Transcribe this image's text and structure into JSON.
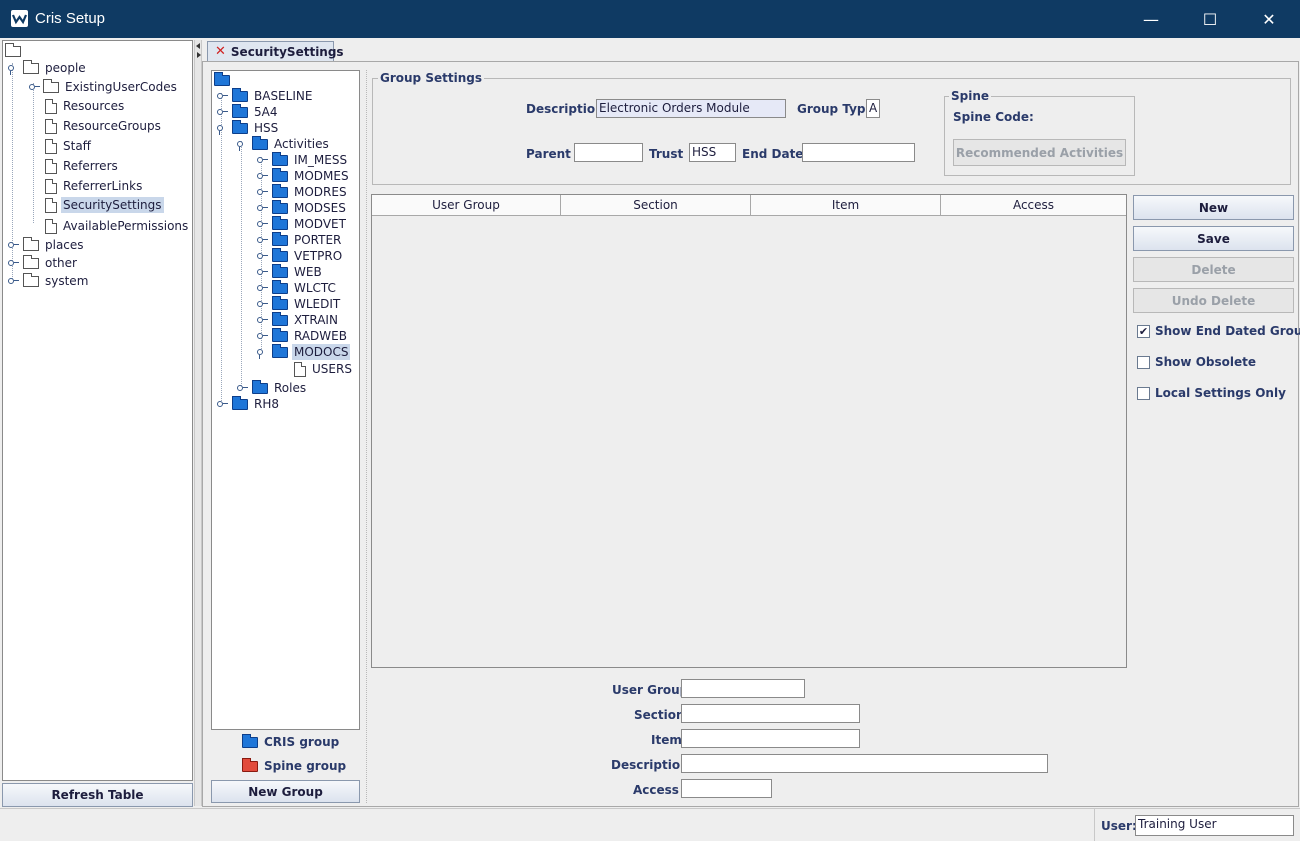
{
  "window": {
    "title": "Cris Setup",
    "minimize": "—",
    "maximize": "☐",
    "close": "✕"
  },
  "left_tree": {
    "items": [
      {
        "label": "",
        "type": "folder"
      },
      {
        "label": "people",
        "type": "folder"
      },
      {
        "label": "ExistingUserCodes",
        "type": "folder"
      },
      {
        "label": "Resources",
        "type": "doc"
      },
      {
        "label": "ResourceGroups",
        "type": "doc"
      },
      {
        "label": "Staff",
        "type": "doc"
      },
      {
        "label": "Referrers",
        "type": "doc"
      },
      {
        "label": "ReferrerLinks",
        "type": "doc"
      },
      {
        "label": "SecuritySettings",
        "type": "doc",
        "selected": true
      },
      {
        "label": "AvailablePermissions",
        "type": "doc"
      },
      {
        "label": "places",
        "type": "folder"
      },
      {
        "label": "other",
        "type": "folder"
      },
      {
        "label": "system",
        "type": "folder"
      }
    ],
    "refresh_button": "Refresh Table"
  },
  "tab": {
    "label": "SecuritySettings"
  },
  "group_tree": {
    "items": [
      {
        "label": "BASELINE"
      },
      {
        "label": "5A4"
      },
      {
        "label": "HSS"
      },
      {
        "label": "Activities"
      },
      {
        "label": "IM_MESS"
      },
      {
        "label": "MODMES"
      },
      {
        "label": "MODRES"
      },
      {
        "label": "MODSES"
      },
      {
        "label": "MODVET"
      },
      {
        "label": "PORTER"
      },
      {
        "label": "VETPRO"
      },
      {
        "label": "WEB"
      },
      {
        "label": "WLCTC"
      },
      {
        "label": "WLEDIT"
      },
      {
        "label": "XTRAIN"
      },
      {
        "label": "RADWEB"
      },
      {
        "label": "MODOCS"
      },
      {
        "label": "USERS"
      },
      {
        "label": "Roles"
      },
      {
        "label": "RH8"
      }
    ],
    "legend_cris": "CRIS group",
    "legend_spine": "Spine group",
    "new_group_button": "New Group"
  },
  "group_settings": {
    "legend": "Group Settings",
    "description_label": "Description",
    "description_value": "Electronic Orders Module",
    "group_type_label": "Group Type",
    "group_type_value": "A",
    "parent_label": "Parent",
    "parent_value": "",
    "trust_label": "Trust",
    "trust_value": "HSS",
    "end_date_label": "End Date",
    "end_date_value": "",
    "spine": {
      "legend": "Spine",
      "code_label": "Spine Code:",
      "recommended_button": "Recommended Activities"
    }
  },
  "table": {
    "columns": [
      "User Group",
      "Section",
      "Item",
      "Access"
    ]
  },
  "actions": {
    "new": "New",
    "save": "Save",
    "delete": "Delete",
    "undo_delete": "Undo Delete",
    "show_end_dated": "Show End Dated Groups",
    "show_end_dated_checked": "✔",
    "show_obsolete": "Show Obsolete",
    "local_only": "Local Settings Only"
  },
  "detail": {
    "user_group_label": "User Group",
    "user_group_value": "",
    "section_label": "Section",
    "section_value": "",
    "item_label": "Item",
    "item_value": "",
    "description_label": "Description",
    "description_value": "",
    "access_label": "Access",
    "access_value": ""
  },
  "status": {
    "user_label": "User:",
    "user_value": "Training User"
  }
}
